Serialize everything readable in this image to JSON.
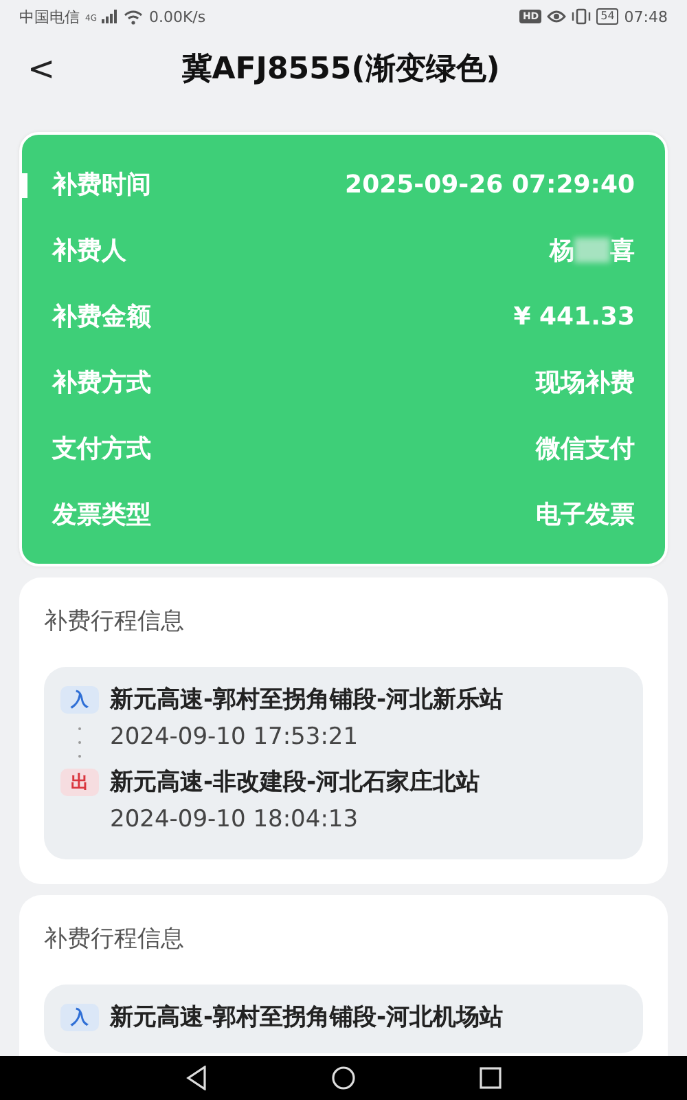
{
  "status_bar": {
    "carrier": "中国电信",
    "network": "4G",
    "speed": "0.00K/s",
    "hd": "HD",
    "battery": "54",
    "time": "07:48"
  },
  "header": {
    "back": "<",
    "title": "冀AFJ8555(渐变绿色)"
  },
  "summary": {
    "rows": [
      {
        "label": "补费时间",
        "value": "2025-09-26 07:29:40",
        "marked": true
      },
      {
        "label": "补费人",
        "value_parts": [
          "杨",
          "喜"
        ],
        "blurred": true,
        "marked": false
      },
      {
        "label": "补费金额",
        "value": "¥ 441.33",
        "marked": false
      },
      {
        "label": "补费方式",
        "value": "现场补费",
        "marked": false
      },
      {
        "label": "支付方式",
        "value": "微信支付",
        "marked": false
      },
      {
        "label": "发票类型",
        "value": "电子发票",
        "marked": false
      }
    ]
  },
  "trips": [
    {
      "heading": "补费行程信息",
      "stops": [
        {
          "kind": "entry",
          "badge": "入",
          "station": "新元高速-郭村至拐角铺段-河北新乐站",
          "time": "2024-09-10 17:53:21"
        },
        {
          "kind": "exit",
          "badge": "出",
          "station": "新元高速-非改建段-河北石家庄北站",
          "time": "2024-09-10 18:04:13"
        }
      ]
    },
    {
      "heading": "补费行程信息",
      "stops": [
        {
          "kind": "entry",
          "badge": "入",
          "station": "新元高速-郭村至拐角铺段-河北机场站"
        }
      ]
    }
  ]
}
